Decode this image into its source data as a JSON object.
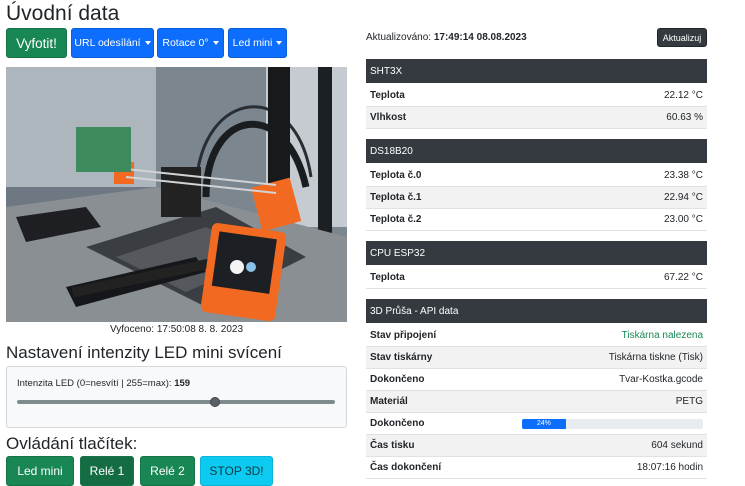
{
  "page_title": "Úvodní data",
  "toolbar": {
    "capture_label": "Vyfotit!",
    "url_label": "URL odesílání",
    "rotation_label": "Rotace 0°",
    "led_label": "Led mini"
  },
  "camera": {
    "caption": "Vyfoceno: 17:50:08 8. 8. 2023"
  },
  "led_section": {
    "heading": "Nastavení intenzity LED mini svícení",
    "label": "Intenzita LED (0=nesvítí | 255=max):",
    "value": "159",
    "level_fraction": 0.623
  },
  "buttons_section": {
    "heading": "Ovládání tlačítek:",
    "buttons": [
      "Led mini",
      "Relé 1",
      "Relé 2",
      "STOP 3D!"
    ]
  },
  "updated": {
    "label": "Aktualizováno:",
    "value": "17:49:14 08.08.2023",
    "button": "Aktualizuj"
  },
  "sht3x": {
    "title": "SHT3X",
    "rows": [
      {
        "k": "Teplota",
        "v": "22.12 °C"
      },
      {
        "k": "Vlhkost",
        "v": "60.63 %"
      }
    ]
  },
  "ds18b20": {
    "title": "DS18B20",
    "rows": [
      {
        "k": "Teplota č.0",
        "v": "23.38 °C"
      },
      {
        "k": "Teplota č.1",
        "v": "22.94 °C"
      },
      {
        "k": "Teplota č.2",
        "v": "23.00 °C"
      }
    ]
  },
  "cpu": {
    "title": "CPU ESP32",
    "rows": [
      {
        "k": "Teplota",
        "v": "67.22 °C"
      }
    ]
  },
  "prusa": {
    "title": "3D Průša - API data",
    "rows": [
      {
        "k": "Stav připojení",
        "v": "Tiskárna nalezena"
      },
      {
        "k": "Stav tiskárny",
        "v": "Tiskárna tiskne",
        "v_extra": "(Tisk)"
      },
      {
        "k": "Dokončeno",
        "v": "Tvar-Kostka.gcode"
      },
      {
        "k": "Materiál",
        "v": "PETG"
      },
      {
        "k": "Dokončeno",
        "progress_label": "24%",
        "progress": 0.24
      },
      {
        "k": "Čas tisku",
        "v": "604 sekund"
      },
      {
        "k": "Čas dokončení",
        "v": "18:07:16 hodin"
      }
    ]
  },
  "colors": {
    "green": "#198754",
    "blue": "#0d6efd",
    "teal": "#0dcaf0",
    "dark": "#343a40"
  }
}
